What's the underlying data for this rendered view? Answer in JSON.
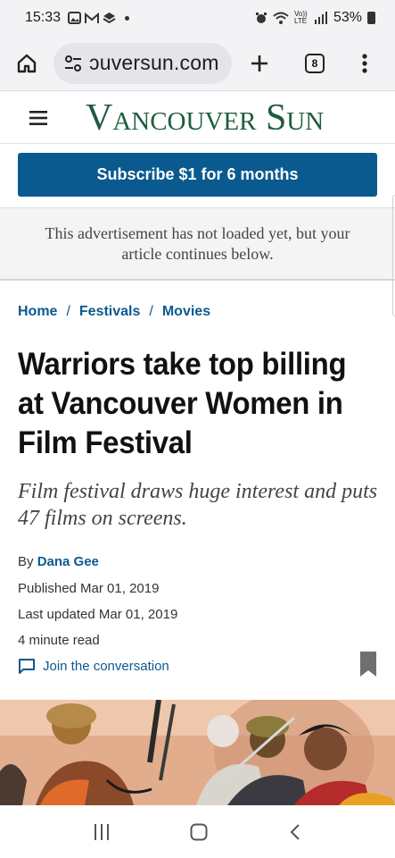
{
  "status_bar": {
    "time": "15:33",
    "volte_label": "Vo)) LTE",
    "battery": "53%"
  },
  "browser": {
    "url_display": "ɔuversun.com",
    "tab_count": "8"
  },
  "site": {
    "logo_text": "Vancouver Sun",
    "subscribe_label": "Subscribe $1 for 6 months",
    "ad_text": "This advertisement has not loaded yet, but your article continues below."
  },
  "breadcrumb": [
    {
      "label": "Home"
    },
    {
      "label": "Festivals"
    },
    {
      "label": "Movies"
    }
  ],
  "breadcrumb_sep": "/",
  "article": {
    "headline": "Warriors take top billing at Vancouver Women in Film Festival",
    "dek": "Film festival draws huge interest and puts 47 films on screens.",
    "by_prefix": "By",
    "author": "Dana Gee",
    "published": "Published Mar 01, 2019",
    "updated": "Last updated Mar 01, 2019",
    "read_time": "4 minute read",
    "conversation_label": "Join the conversation"
  },
  "colors": {
    "brand_blue": "#0a5a8f",
    "logo_green": "#1f5c3f"
  }
}
